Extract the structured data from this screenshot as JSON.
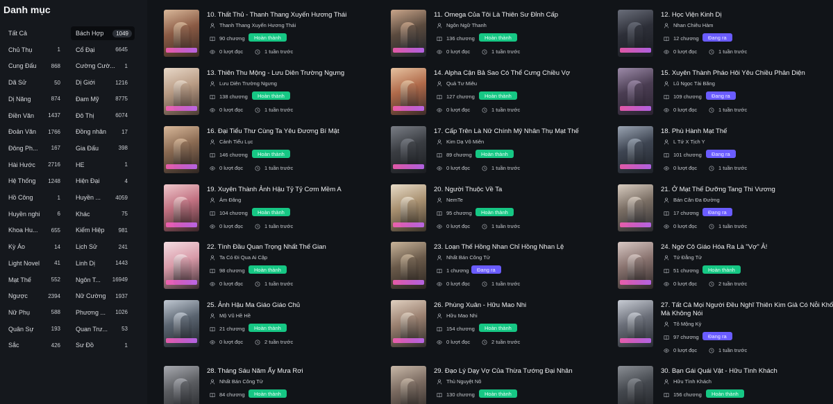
{
  "sidebar": {
    "title": "Danh mục",
    "col1": [
      {
        "label": "Tất Cả",
        "count": ""
      },
      {
        "label": "Chủ Thụ",
        "count": "1"
      },
      {
        "label": "Cung Đấu",
        "count": "868"
      },
      {
        "label": "Dã Sử",
        "count": "50"
      },
      {
        "label": "Dị Năng",
        "count": "874"
      },
      {
        "label": "Điền Văn",
        "count": "1437"
      },
      {
        "label": "Đoản Văn",
        "count": "1766"
      },
      {
        "label": "Đông Ph...",
        "count": "167"
      },
      {
        "label": "Hài Hước",
        "count": "2716"
      },
      {
        "label": "Hệ Thống",
        "count": "1248"
      },
      {
        "label": "Hồ Công",
        "count": "1"
      },
      {
        "label": "Huyền nghi",
        "count": "6"
      },
      {
        "label": "Khoa Hu...",
        "count": "655"
      },
      {
        "label": "Kỳ Ảo",
        "count": "14"
      },
      {
        "label": "Light Novel",
        "count": "41"
      },
      {
        "label": "Mạt Thế",
        "count": "552"
      },
      {
        "label": "Ngược",
        "count": "2394"
      },
      {
        "label": "Nữ Phụ",
        "count": "588"
      },
      {
        "label": "Quân Sự",
        "count": "193"
      },
      {
        "label": "Sắc",
        "count": "426"
      }
    ],
    "col2": [
      {
        "label": "Bách Hợp",
        "count": "1049"
      },
      {
        "label": "Cổ Đại",
        "count": "6645"
      },
      {
        "label": "Cường Cườ...",
        "count": "1"
      },
      {
        "label": "Dị Giới",
        "count": "1216"
      },
      {
        "label": "Đam Mỹ",
        "count": "8775"
      },
      {
        "label": "Đô Thị",
        "count": "6074"
      },
      {
        "label": "Đồng nhân",
        "count": "17"
      },
      {
        "label": "Gia Đấu",
        "count": "398"
      },
      {
        "label": "HE",
        "count": "1"
      },
      {
        "label": "Hiện Đại",
        "count": "4"
      },
      {
        "label": "Huyền ...",
        "count": "4059"
      },
      {
        "label": "Khác",
        "count": "75"
      },
      {
        "label": "Kiếm Hiệp",
        "count": "981"
      },
      {
        "label": "Lịch Sử",
        "count": "241"
      },
      {
        "label": "Linh Dị",
        "count": "1443"
      },
      {
        "label": "Ngôn T...",
        "count": "16949"
      },
      {
        "label": "Nữ Cường",
        "count": "1937"
      },
      {
        "label": "Phương ...",
        "count": "1026"
      },
      {
        "label": "Quan Trư...",
        "count": "53"
      },
      {
        "label": "Sư Đồ",
        "count": "1"
      }
    ]
  },
  "colors": {
    "completed": "#16c784",
    "ongoing": "#6a5cff"
  },
  "books": [
    {
      "title": "10. Thất Thủ - Thanh Thang Xuyến Hương Thái",
      "author": "Thanh Thang Xuyến Hương Thái",
      "chapters": "90 chương",
      "status": "Hoàn thành",
      "state": "done",
      "views": "0 lượt đọc",
      "updated": "1 tuần trước"
    },
    {
      "title": "11. Omega Của Tôi Là Thiên Sư Đỉnh Cấp",
      "author": "Ngôn Ngữ Thanh",
      "chapters": "136 chương",
      "status": "Hoàn thành",
      "state": "done",
      "views": "0 lượt đọc",
      "updated": "1 tuần trước"
    },
    {
      "title": "12. Học Viện Kinh Dị",
      "author": "Nhan Chiêu Hàm",
      "chapters": "12 chương",
      "status": "Đang ra",
      "state": "ongoing",
      "views": "0 lượt đọc",
      "updated": "1 tuần trước"
    },
    {
      "title": "13. Thiên Thu Mộng - Lưu Diên Trường Ngưng",
      "author": "Lưu Diên Trường Ngưng",
      "chapters": "138 chương",
      "status": "Hoàn thành",
      "state": "done",
      "views": "0 lượt đọc",
      "updated": "1 tuần trước"
    },
    {
      "title": "14. Alpha Cận Bả Sao Có Thể Cưng Chiều Vợ",
      "author": "Quả Tư Miêu",
      "chapters": "127 chương",
      "status": "Hoàn thành",
      "state": "done",
      "views": "0 lượt đọc",
      "updated": "1 tuần trước"
    },
    {
      "title": "15. Xuyên Thành Pháo Hôi Yêu Chiều Phản Diện",
      "author": "Lũ Ngọc Tài Băng",
      "chapters": "109 chương",
      "status": "Đang ra",
      "state": "ongoing",
      "views": "0 lượt đọc",
      "updated": "1 tuần trước"
    },
    {
      "title": "16. Đại Tiểu Thư Cùng Ta Yêu Đương Bí Mật",
      "author": "Cảnh Tiểu Lục",
      "chapters": "146 chương",
      "status": "Hoàn thành",
      "state": "done",
      "views": "0 lượt đọc",
      "updated": "1 tuần trước"
    },
    {
      "title": "17. Cấp Trên Là Nữ Chính Mỹ Nhân Thụ Mạt Thế",
      "author": "Kim Dạ Vô Miên",
      "chapters": "89 chương",
      "status": "Hoàn thành",
      "state": "done",
      "views": "0 lượt đọc",
      "updated": "1 tuần trước"
    },
    {
      "title": "18. Phù Hành Mạt Thế",
      "author": "L Tứ X Tịch Y",
      "chapters": "101 chương",
      "status": "Đang ra",
      "state": "ongoing",
      "views": "0 lượt đọc",
      "updated": "1 tuần trước"
    },
    {
      "title": "19. Xuyên Thành Ảnh Hậu Tỷ Tỷ Cơm Mềm A",
      "author": "Ám Đăng",
      "chapters": "104 chương",
      "status": "Hoàn thành",
      "state": "done",
      "views": "0 lượt đọc",
      "updated": "1 tuần trước"
    },
    {
      "title": "20. Người Thuộc Về Ta",
      "author": "NemTe",
      "chapters": "95 chương",
      "status": "Hoàn thành",
      "state": "done",
      "views": "0 lượt đọc",
      "updated": "1 tuần trước"
    },
    {
      "title": "21. Ở Mạt Thế Dưỡng Tang Thi Vương",
      "author": "Bán Cân Đa Đường",
      "chapters": "17 chương",
      "status": "Đang ra",
      "state": "ongoing",
      "views": "0 lượt đọc",
      "updated": "1 tuần trước"
    },
    {
      "title": "22. Tình Đầu Quan Trọng Nhất Thế Gian",
      "author": "Ta Có Đi Qua Ai Cập",
      "chapters": "98 chương",
      "status": "Hoàn thành",
      "state": "done",
      "views": "0 lượt đọc",
      "updated": "1 tuần trước"
    },
    {
      "title": "23. Loạn Thế Hồng Nhan Chỉ Hồng Nhan Lệ",
      "author": "Nhất Bán Công Tử",
      "chapters": "1 chương",
      "status": "Đang ra",
      "state": "ongoing",
      "views": "0 lượt đọc",
      "updated": "1 tuần trước"
    },
    {
      "title": "24. Ngờ Cô Giáo Hóa Ra Là \"Vợ\" Ả!",
      "author": "Tứ Đằng Tử",
      "chapters": "51 chương",
      "status": "Hoàn thành",
      "state": "done",
      "views": "0 lượt đọc",
      "updated": "2 tuần trước"
    },
    {
      "title": "25. Ảnh Hậu Ma Giáo Giáo Chủ",
      "author": "Mộ Vũ Hề Hề",
      "chapters": "21 chương",
      "status": "Hoàn thành",
      "state": "done",
      "views": "0 lượt đọc",
      "updated": "2 tuần trước"
    },
    {
      "title": "26. Phùng Xuân - Hữu Mao Nhi",
      "author": "Hữu Mao Nhi",
      "chapters": "154 chương",
      "status": "Hoàn thành",
      "state": "done",
      "views": "0 lượt đọc",
      "updated": "2 tuần trước"
    },
    {
      "title": "27. Tất Cả Mọi Người Đều Nghĩ Thiên Kim Giả Có Nỗi Khổ Mà Không Nói",
      "author": "Tô Mộng Kỳ",
      "chapters": "97 chương",
      "status": "Đang ra",
      "state": "ongoing",
      "views": "0 lượt đọc",
      "updated": "1 tuần trước"
    },
    {
      "title": "28. Tháng Sáu Năm Ấy Mưa Rơi",
      "author": "Nhất Bán Công Tử",
      "chapters": "84 chương",
      "status": "Hoàn thành",
      "state": "done",
      "views": "",
      "updated": ""
    },
    {
      "title": "29. Đạo Lý Dạy Vợ Của Thừa Tướng Đại Nhân",
      "author": "Thù Nguyệt Nô",
      "chapters": "130 chương",
      "status": "Hoàn thành",
      "state": "done",
      "views": "",
      "updated": ""
    },
    {
      "title": "30. Bạn Gái Quái Vật - Hữu Tình Khách",
      "author": "Hữu Tình Khách",
      "chapters": "156 chương",
      "status": "Hoàn thành",
      "state": "done",
      "views": "",
      "updated": ""
    }
  ]
}
